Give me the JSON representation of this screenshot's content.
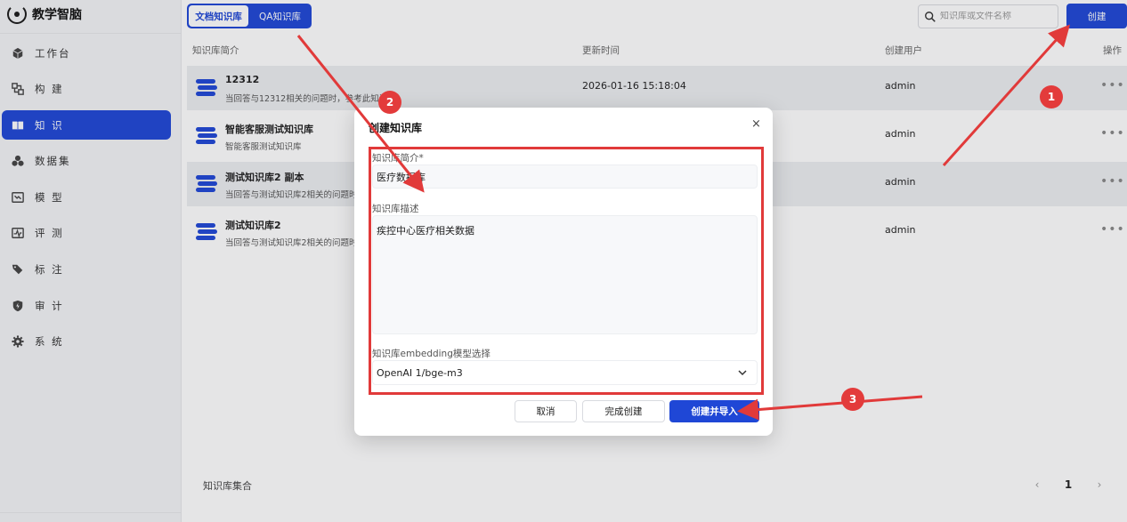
{
  "app": {
    "name": "教学智脑"
  },
  "sidebar": {
    "items": [
      {
        "label": "工作台",
        "icon": "cube-icon"
      },
      {
        "label": "构 建",
        "icon": "build-icon"
      },
      {
        "label": "知 识",
        "icon": "book-icon",
        "active": true
      },
      {
        "label": "数据集",
        "icon": "dataset-icon"
      },
      {
        "label": "模 型",
        "icon": "model-icon"
      },
      {
        "label": "评 测",
        "icon": "evaluate-icon"
      },
      {
        "label": "标 注",
        "icon": "tag-icon"
      },
      {
        "label": "审 计",
        "icon": "shield-icon"
      },
      {
        "label": "系 统",
        "icon": "gear-icon"
      }
    ]
  },
  "topbar": {
    "tabs": [
      "文档知识库",
      "QA知识库"
    ],
    "search_placeholder": "知识库或文件名称",
    "create_label": "创建"
  },
  "table": {
    "headers": {
      "intro": "知识库简介",
      "updated": "更新时间",
      "user": "创建用户",
      "actions": "操作"
    },
    "rows": [
      {
        "title": "12312",
        "desc": "当回答与12312相关的问题时，参考此知识库",
        "time": "2026-01-16 15:18:04",
        "user": "admin",
        "more": "•••"
      },
      {
        "title": "智能客服测试知识库",
        "desc": "智能客服测试知识库",
        "time": "",
        "user": "admin",
        "more": "•••"
      },
      {
        "title": "测试知识库2 副本",
        "desc": "当回答与测试知识库2相关的问题时，",
        "time": "",
        "user": "admin",
        "more": "•••"
      },
      {
        "title": "测试知识库2",
        "desc": "当回答与测试知识库2相关的问题时，",
        "time": "",
        "user": "admin",
        "more": "•••"
      }
    ]
  },
  "footer": {
    "label": "知识库集合",
    "page": "1",
    "prev": "‹",
    "next": "›"
  },
  "modal": {
    "title": "创建知识库",
    "close": "×",
    "name_label": "知识库简介*",
    "name_value": "医疗数据库",
    "desc_label": "知识库描述",
    "desc_value": "疾控中心医疗相关数据",
    "model_label": "知识库embedding模型选择",
    "model_value": "OpenAI 1/bge-m3",
    "cancel": "取消",
    "finish": "完成创建",
    "create_import": "创建并导入"
  },
  "annotations": {
    "badge1": "1",
    "badge2": "2",
    "badge3": "3",
    "color": "#e13a3a"
  },
  "colors": {
    "brand": "#1f47d6",
    "annotation": "#e13a3a"
  }
}
